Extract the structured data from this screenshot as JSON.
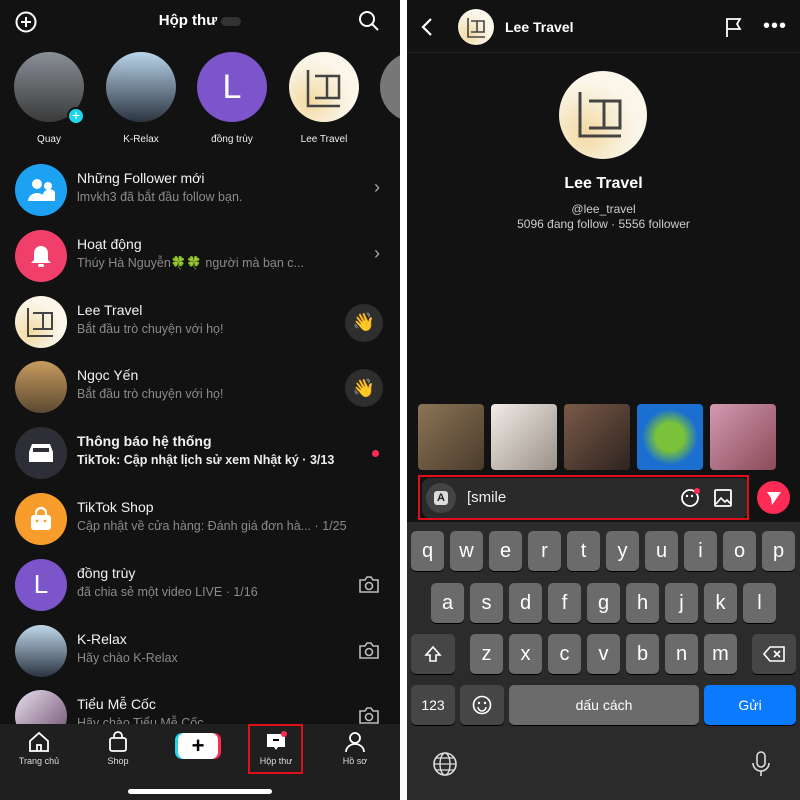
{
  "inbox": {
    "title": "Hộp thư",
    "stories": [
      {
        "name": "Quay"
      },
      {
        "name": "K-Relax"
      },
      {
        "name": "đồng trùy",
        "initial": "L"
      },
      {
        "name": "Lee Travel"
      }
    ],
    "rows": [
      {
        "title": "Những Follower mới",
        "subtitle": "lmvkh3 đã bắt đầu follow bạn.",
        "icon": "people-icon",
        "color": "#1DA1F2",
        "action": "chevron"
      },
      {
        "title": "Hoạt động",
        "subtitle": "Thúy Hà Nguyễn🍀🍀 người mà bạn c...",
        "icon": "bell-icon",
        "color": "#F03F6B",
        "action": "chevron"
      },
      {
        "title": "Lee Travel",
        "subtitle": "Bắt đầu trò chuyện với họ!",
        "icon": "lee-logo",
        "action": "wave"
      },
      {
        "title": "Ngọc Yến",
        "subtitle": "Bắt đầu trò chuyện với họ!",
        "icon": "photo-avatar",
        "action": "wave"
      },
      {
        "title": "Thông báo hệ thống",
        "subtitle": "TikTok: Cập nhật lịch sử xem Nhật ký · 3/13",
        "icon": "inbox-tray-icon",
        "color": "#2e2e36",
        "action": "dot",
        "bold": true
      },
      {
        "title": "TikTok Shop",
        "subtitle": "Cập nhật về cửa hàng: Đánh giá đơn hà... · 1/25",
        "icon": "shopping-bag-icon",
        "color": "#F89C2C",
        "action": "none"
      },
      {
        "title": "đồng trùy",
        "subtitle": "đã chia sẻ một video LIVE · 1/16",
        "icon": "initial",
        "initial": "L",
        "color": "#7B55C9",
        "action": "camera"
      },
      {
        "title": "K-Relax",
        "subtitle": "Hãy chào K-Relax",
        "icon": "photo-avatar",
        "action": "camera"
      },
      {
        "title": "Tiểu Mễ Cốc",
        "subtitle": "Hãy chào Tiểu Mễ Cốc",
        "icon": "photo-avatar",
        "action": "camera"
      }
    ],
    "nav": [
      {
        "label": "Trang chủ"
      },
      {
        "label": "Shop"
      },
      {
        "label": ""
      },
      {
        "label": "Hộp thư",
        "active": true
      },
      {
        "label": "Hồ sơ"
      }
    ]
  },
  "chat": {
    "header_name": "Lee Travel",
    "profile_name": "Lee Travel",
    "handle": "@lee_travel",
    "stats": "5096 đang follow · 5556 follower",
    "input_value": "[smile",
    "keyboard": {
      "row1": [
        "q",
        "w",
        "e",
        "r",
        "t",
        "y",
        "u",
        "i",
        "o",
        "p"
      ],
      "row2": [
        "a",
        "s",
        "d",
        "f",
        "g",
        "h",
        "j",
        "k",
        "l"
      ],
      "row3": [
        "z",
        "x",
        "c",
        "v",
        "b",
        "n",
        "m"
      ],
      "num": "123",
      "space": "dấu cách",
      "send": "Gửi"
    }
  },
  "colors": {
    "accent": "#FE2C55",
    "highlight": "#E0101A",
    "keyboard_send": "#0A7AFF"
  }
}
